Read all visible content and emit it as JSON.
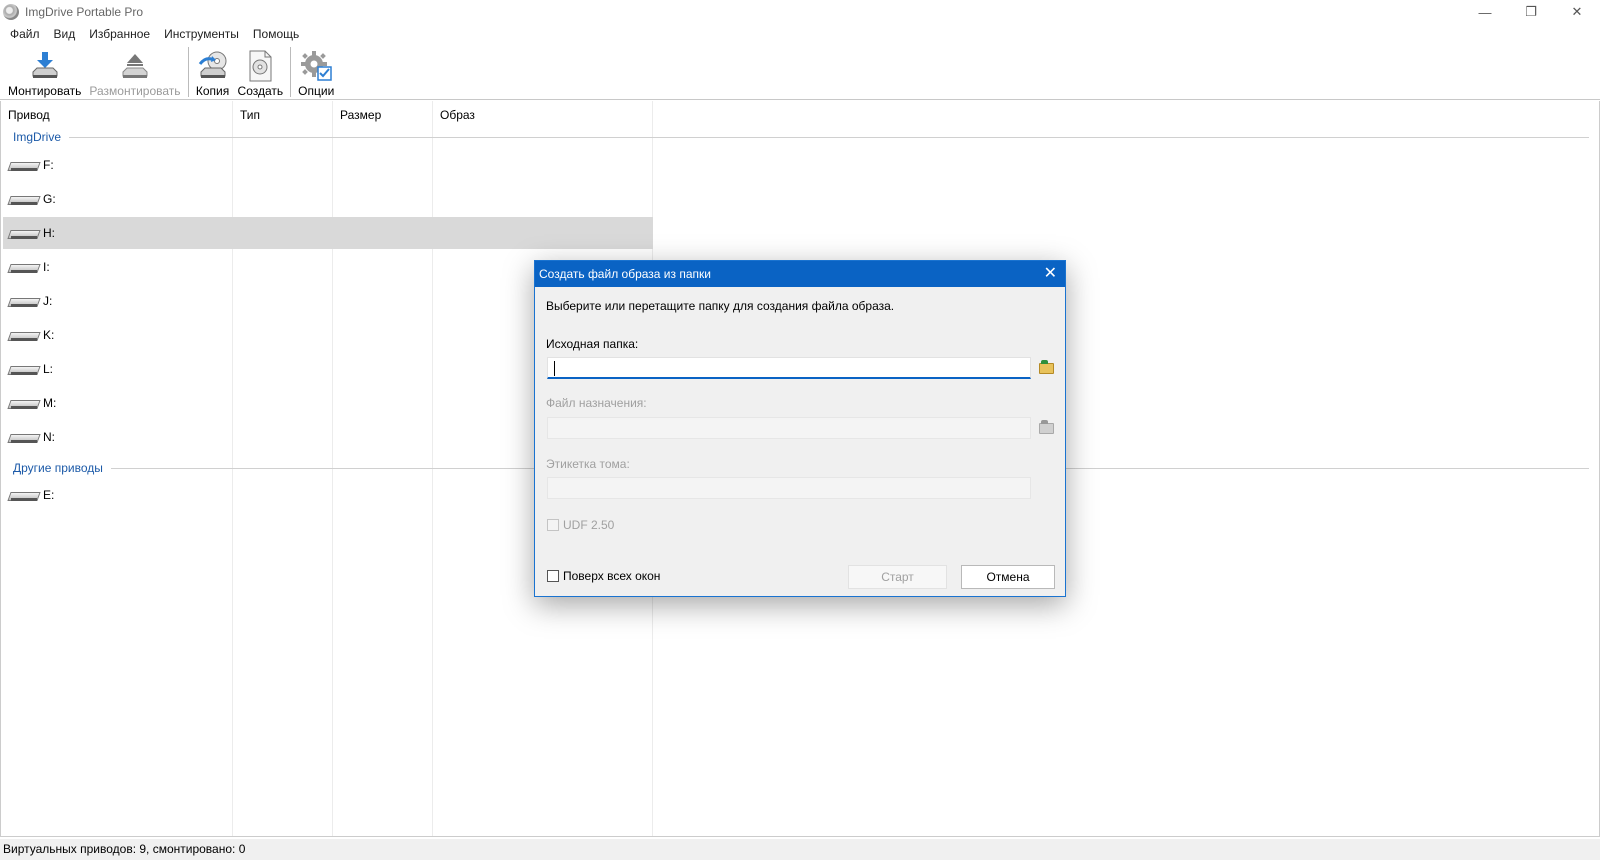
{
  "window": {
    "title": "ImgDrive Portable Pro",
    "controls": {
      "minimize": "—",
      "restore": "❐",
      "close": "✕"
    }
  },
  "menu": [
    "Файл",
    "Вид",
    "Избранное",
    "Инструменты",
    "Помощь"
  ],
  "toolbar": {
    "mount": "Монтировать",
    "unmount": "Размонтировать",
    "copy": "Копия",
    "create": "Создать",
    "options": "Опции"
  },
  "columns": [
    "Привод",
    "Тип",
    "Размер",
    "Образ"
  ],
  "groups": {
    "imgdrive": "ImgDrive",
    "other": "Другие приводы"
  },
  "drives_imgdrive": [
    "F:",
    "G:",
    "H:",
    "I:",
    "J:",
    "K:",
    "L:",
    "M:",
    "N:"
  ],
  "drives_other": [
    "E:"
  ],
  "selected_drive": "H:",
  "status": "Виртуальных приводов: 9, смонтировано: 0",
  "dialog": {
    "title": "Создать файл образа из папки",
    "instruction": "Выберите или перетащите папку для создания файла образа.",
    "source_label": "Исходная папка:",
    "source_value": "",
    "dest_label": "Файл назначения:",
    "dest_value": "",
    "volume_label": "Этикетка тома:",
    "volume_value": "",
    "udf_label": "UDF 2.50",
    "on_top_label": "Поверх всех окон",
    "start_button": "Старт",
    "cancel_button": "Отмена",
    "close": "✕"
  }
}
